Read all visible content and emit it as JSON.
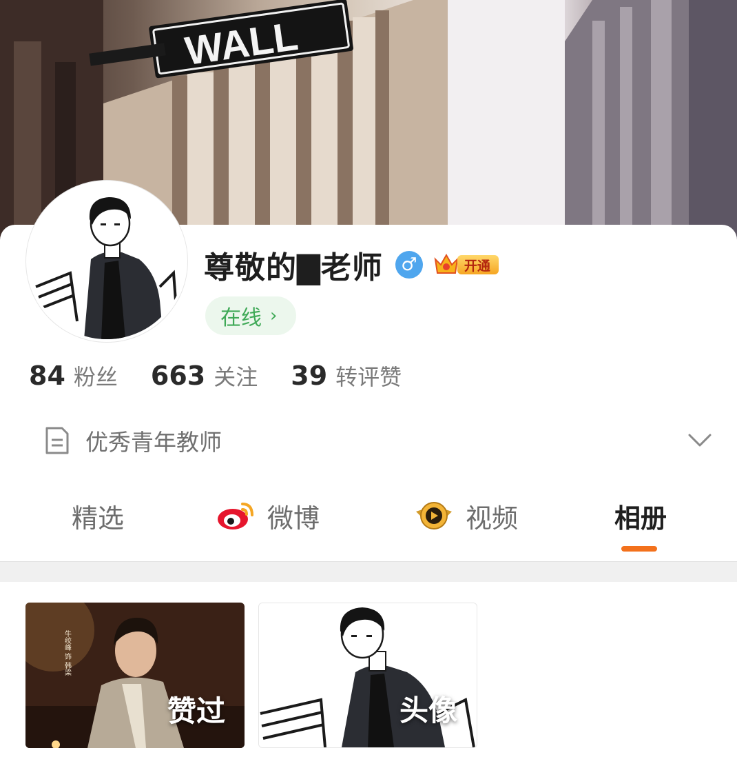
{
  "cover": {
    "sign_text": "WALL"
  },
  "profile": {
    "name": "尊敬的▇老师",
    "gender_symbol": "♂",
    "vip_label": "开通",
    "status_label": "在线",
    "status_chevron": "›"
  },
  "stats": [
    {
      "num": "84",
      "label": "粉丝"
    },
    {
      "num": "663",
      "label": "关注"
    },
    {
      "num": "39",
      "label": "转评赞"
    }
  ],
  "bio": {
    "text": "优秀青年教师",
    "icon": "document-icon",
    "expand_icon": "chevron-down-icon"
  },
  "tabs": [
    {
      "label": "精选",
      "icon": null,
      "active": false
    },
    {
      "label": "微博",
      "icon": "weibo-icon",
      "active": false
    },
    {
      "label": "视频",
      "icon": "video-badge-icon",
      "active": false
    },
    {
      "label": "相册",
      "icon": null,
      "active": true
    }
  ],
  "albums": [
    {
      "label": "赞过",
      "photo_caption": "牛绞峰 饰 韩梁"
    },
    {
      "label": "头像"
    }
  ],
  "colors": {
    "accent": "#f3711c",
    "online_green": "#3fa957",
    "gender_blue": "#4fa6ee",
    "vip_gold": "#f5a623"
  }
}
